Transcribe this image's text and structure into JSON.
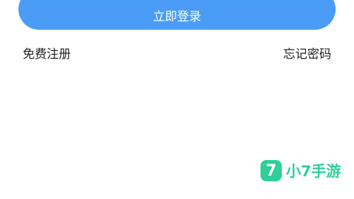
{
  "login_button": {
    "label": "立即登录"
  },
  "links": {
    "register": "免费注册",
    "forgot_password": "忘记密码"
  },
  "watermark": {
    "logo_glyph": "7",
    "text": "小7手游"
  },
  "colors": {
    "primary": "#4a9cf7",
    "link_text": "#1f1f1f",
    "watermark_green": "#2ecf9a"
  }
}
